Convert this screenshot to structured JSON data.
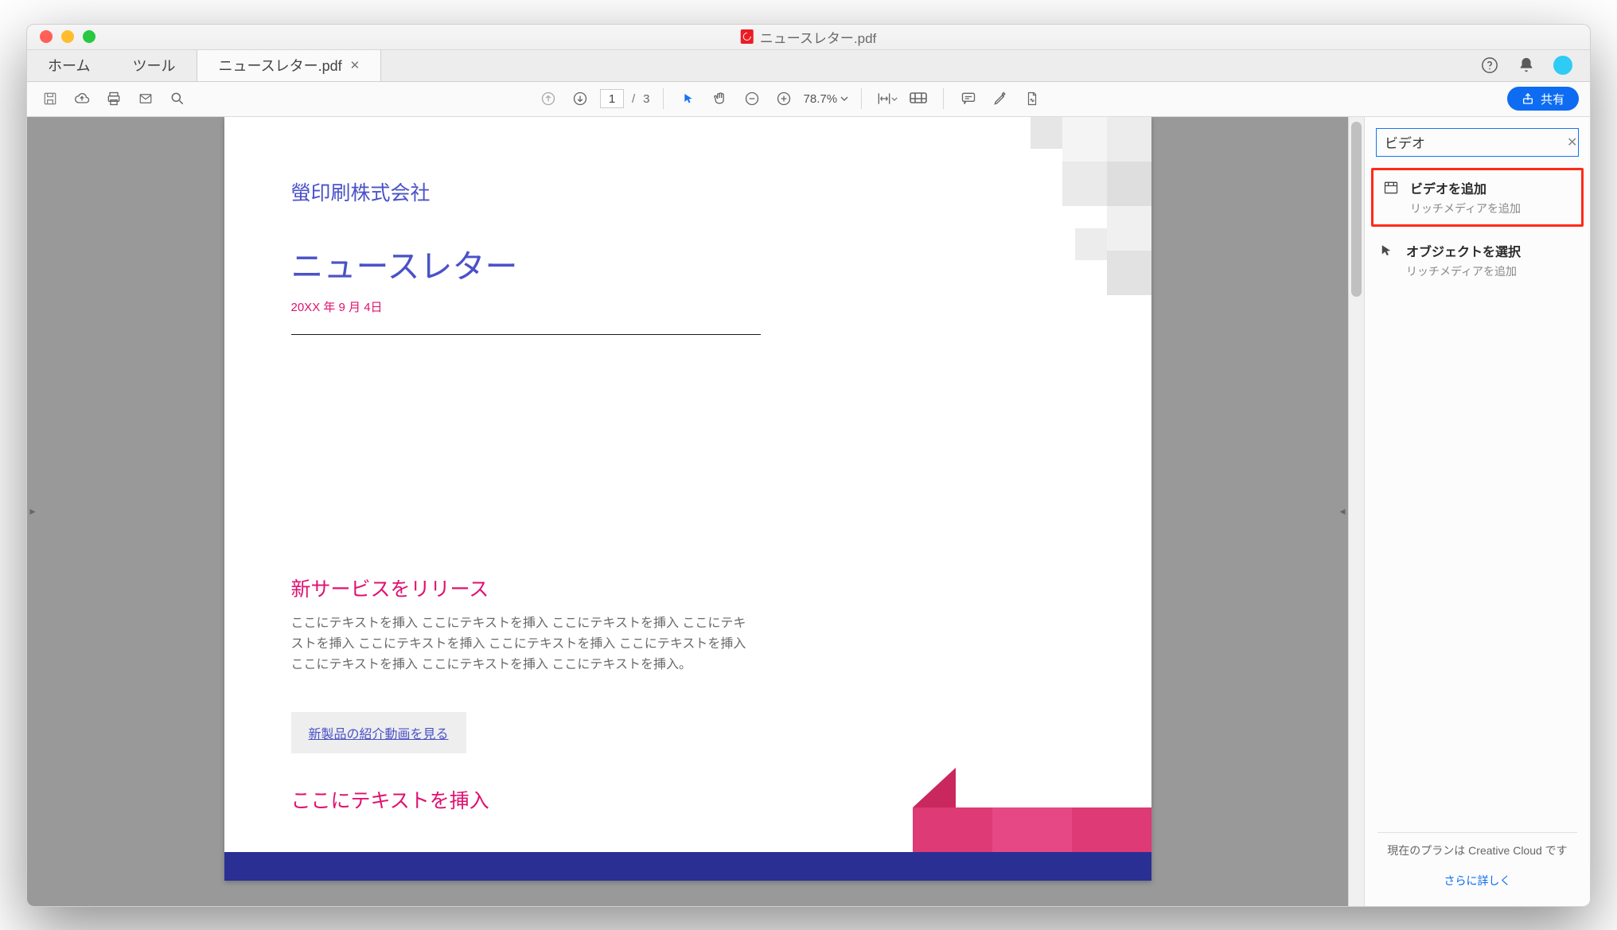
{
  "window": {
    "title": "ニュースレター.pdf"
  },
  "tabs": {
    "home": "ホーム",
    "tools": "ツール",
    "doc": "ニュースレター.pdf"
  },
  "toolbar": {
    "page_current": "1",
    "page_sep": "/",
    "page_total": "3",
    "zoom": "78.7%",
    "share": "共有"
  },
  "document": {
    "company": "螢印刷株式会社",
    "title": "ニュースレター",
    "date": "20XX 年 9 月 4日",
    "section1_title": "新サービスをリリース",
    "section1_body": "ここにテキストを挿入 ここにテキストを挿入 ここにテキストを挿入 ここにテキストを挿入 ここにテキストを挿入 ここにテキストを挿入 ここにテキストを挿入 ここにテキストを挿入 ここにテキストを挿入 ここにテキストを挿入。",
    "link_button": "新製品の紹介動画を見る",
    "section2_title": "ここにテキストを挿入"
  },
  "side": {
    "search_value": "ビデオ",
    "results": [
      {
        "title": "ビデオを追加",
        "sub": "リッチメディアを追加",
        "icon": "video"
      },
      {
        "title": "オブジェクトを選択",
        "sub": "リッチメディアを追加",
        "icon": "pointer"
      }
    ],
    "plan_text": "現在のプランは Creative Cloud です",
    "more_link": "さらに詳しく"
  }
}
